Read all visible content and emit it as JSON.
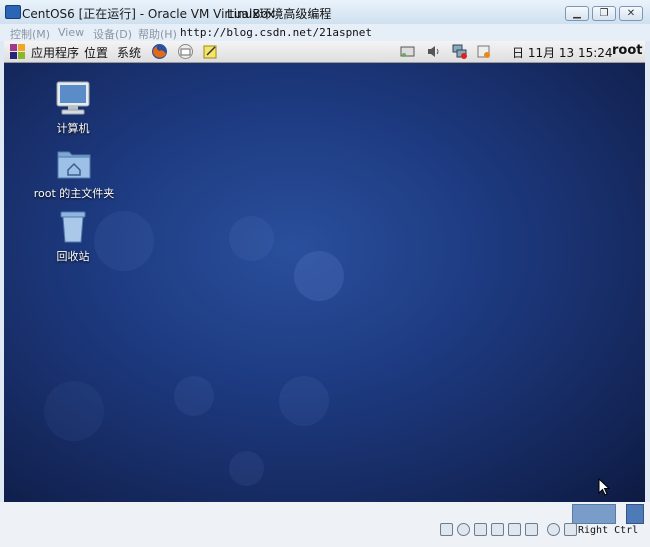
{
  "window": {
    "title": "CentOS6 [正在运行] - Oracle VM VirtualBox",
    "title_extra": "Linux环境高级编程",
    "controls": [
      "minimize-icon",
      "restore-icon",
      "close-icon"
    ]
  },
  "menubar": {
    "items": [
      "控制(M)",
      "View",
      "设备(D)",
      "帮助(H)"
    ],
    "url": "http://blog.csdn.net/21aspnet"
  },
  "panel": {
    "applications": "应用程序",
    "places": "位置",
    "system": "系统",
    "clock": "日 11月 13 15:24",
    "user": "root"
  },
  "desktop": {
    "icons": [
      {
        "label": "计算机",
        "icon": "computer-icon"
      },
      {
        "label": "root 的主文件夹",
        "icon": "home-folder-icon"
      },
      {
        "label": "回收站",
        "icon": "trash-icon"
      }
    ],
    "background_color": "#1d3a80"
  },
  "statusbar": {
    "host_key": "Right Ctrl"
  }
}
